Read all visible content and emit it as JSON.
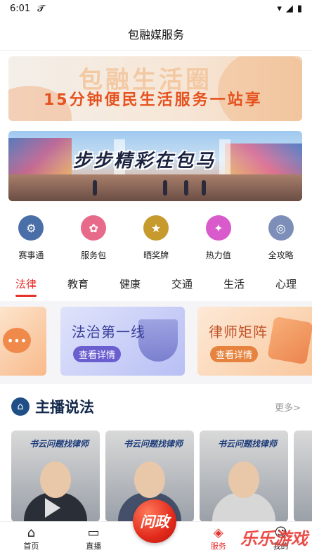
{
  "status": {
    "time": "6:01",
    "extra_icon": "𝓣",
    "wifi": "▾",
    "signal": "◢",
    "battery": "▮"
  },
  "header": {
    "title": "包融媒服务"
  },
  "banner1": {
    "bg_title": "包融生活圈",
    "text": "15分钟便民生活服务一站享"
  },
  "banner2": {
    "slogan": "步步精彩在包马"
  },
  "quick": [
    {
      "label": "赛事通",
      "icon": "robot-icon",
      "color": "#4a6fa8",
      "glyph": "⚙"
    },
    {
      "label": "服务包",
      "icon": "deer-icon",
      "color": "#e86a8a",
      "glyph": "✿"
    },
    {
      "label": "晒奖牌",
      "icon": "medal-icon",
      "color": "#c79a2d",
      "glyph": "★"
    },
    {
      "label": "热力值",
      "icon": "flame-icon",
      "color": "#d85acb",
      "glyph": "✦"
    },
    {
      "label": "全攻略",
      "icon": "badge-icon",
      "color": "#7d8fb8",
      "glyph": "◎"
    }
  ],
  "tabs": [
    "法律",
    "教育",
    "健康",
    "交通",
    "生活",
    "心理"
  ],
  "cards": [
    {
      "title": "",
      "button": ""
    },
    {
      "title": "法治第一线",
      "button": "查看详情"
    },
    {
      "title": "律师矩阵",
      "button": "查看详情"
    }
  ],
  "anchor": {
    "title": "主播说法",
    "more": "更多>"
  },
  "videos": [
    {
      "tag": "书云问题找律师"
    },
    {
      "tag": "书云问题找律师"
    },
    {
      "tag": "书云问题找律师"
    }
  ],
  "nav": {
    "home": "首页",
    "live": "直播",
    "center": "问政",
    "service": "服务",
    "mine": "我的"
  },
  "watermark": "乐乐游戏",
  "colors": {
    "accent": "#e5322d",
    "brand_blue": "#13294b"
  }
}
